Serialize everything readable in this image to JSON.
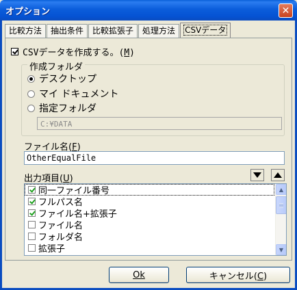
{
  "window": {
    "title": "オプション"
  },
  "tabs": [
    {
      "label": "比較方法",
      "active": false
    },
    {
      "label": "抽出条件",
      "active": false
    },
    {
      "label": "比較拡張子",
      "active": false
    },
    {
      "label": "処理方法",
      "active": false
    },
    {
      "label": "CSVデータ",
      "active": true
    }
  ],
  "csv": {
    "create_label": "CSVデータを作成する。(",
    "create_key": "M",
    "create_suffix": ")",
    "checked": true
  },
  "folder_group": {
    "legend": "作成フォルダ",
    "options": [
      {
        "label": "デスクトップ",
        "selected": true
      },
      {
        "label": "マイ ドキュメント",
        "selected": false
      },
      {
        "label": "指定フォルダ",
        "selected": false
      }
    ],
    "path_value": "C:¥DATA"
  },
  "filename": {
    "label": "ファイル名(",
    "key": "F",
    "suffix": ")",
    "value": "OtherEqualFile"
  },
  "output": {
    "label": "出力項目(",
    "key": "U",
    "suffix": ")",
    "items": [
      {
        "label": "同一ファイル番号",
        "checked": true
      },
      {
        "label": "フルパス名",
        "checked": true
      },
      {
        "label": "ファイル名+拡張子",
        "checked": true
      },
      {
        "label": "ファイル名",
        "checked": false
      },
      {
        "label": "フォルダ名",
        "checked": false
      },
      {
        "label": "拡張子",
        "checked": false
      }
    ]
  },
  "buttons": {
    "ok_label": "Ok",
    "cancel_label": "キャンセル(",
    "cancel_key": "C",
    "cancel_suffix": ")"
  },
  "icons": {
    "close": "close-icon",
    "move_down": "triangle-down-icon",
    "move_up": "triangle-up-icon"
  },
  "colors": {
    "titlebar": "#0553d3",
    "dialog_bg": "#ece9d8",
    "check_green": "#21a121"
  }
}
